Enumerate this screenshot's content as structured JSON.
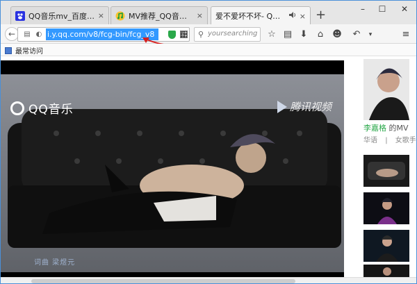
{
  "tabs": [
    {
      "label": "QQ音乐mv_百度搜索",
      "close": "×",
      "favicon": "baidu-paw-icon"
    },
    {
      "label": "MV推荐_QQ音乐-听我想...",
      "close": "×",
      "favicon": "qq-music-icon"
    },
    {
      "label": "爱不爱坏不坏- QQ音乐 -...",
      "close": "×",
      "favicon": "none",
      "audio": "speaker-icon"
    }
  ],
  "new_tab": "+",
  "window_controls": {
    "minimize": "–",
    "maximize": "☐",
    "close": "✕"
  },
  "address_bar": {
    "url": "i.y.qq.com/v8/fcg-bin/fcg_v8"
  },
  "search": {
    "placeholder": "yoursearching"
  },
  "bookmarks": {
    "item": "最常访问"
  },
  "video": {
    "logo_left": "QQ音乐",
    "logo_right": "腾讯视频",
    "credit": "词曲  梁煜元"
  },
  "sidebar": {
    "singer": "李嘉格",
    "singer_suffix": " 的MV",
    "tag1": "华语",
    "separator": "|",
    "tag2": "女歌手"
  },
  "colors": {
    "accent": "#3399ff",
    "singer_green": "#2aa84a",
    "arrow_red": "#d62020"
  }
}
